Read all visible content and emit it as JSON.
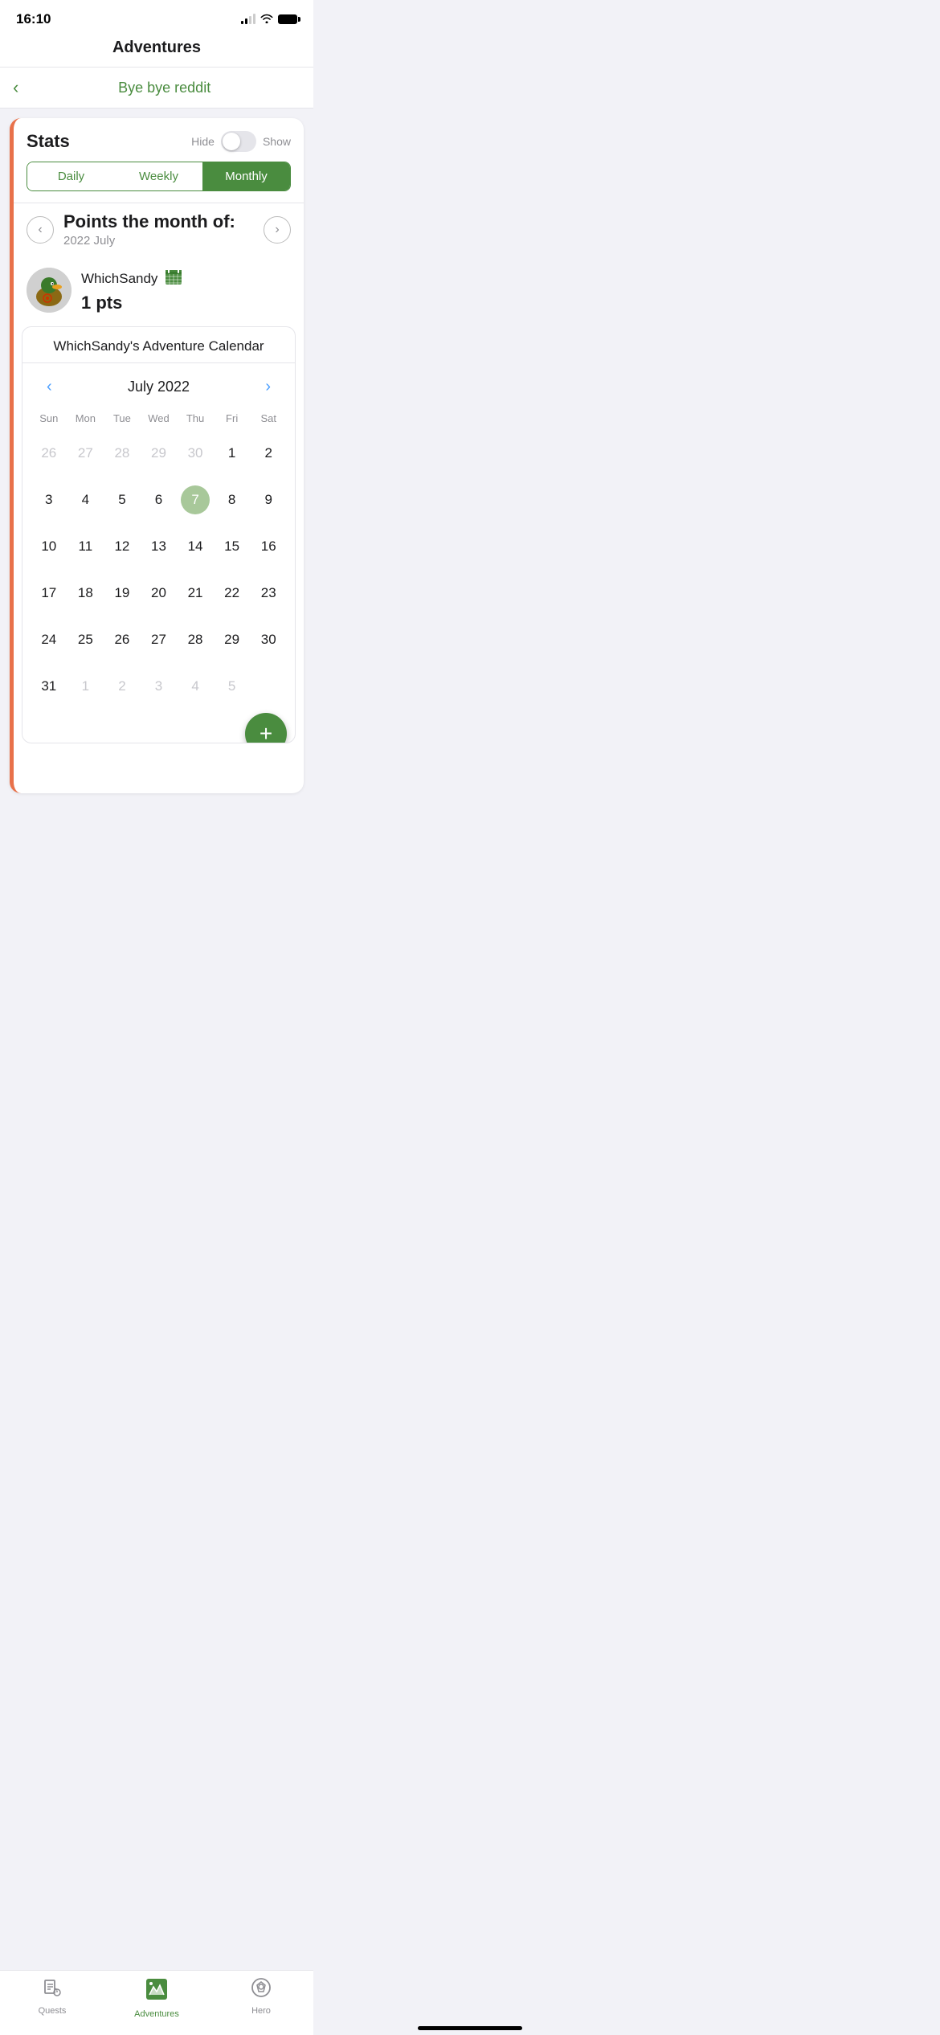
{
  "statusBar": {
    "time": "16:10"
  },
  "header": {
    "title": "Adventures"
  },
  "nav": {
    "backIcon": "‹",
    "adventureName": "Bye bye reddit"
  },
  "stats": {
    "title": "Stats",
    "hideLabel": "Hide",
    "showLabel": "Show",
    "tabs": [
      {
        "id": "daily",
        "label": "Daily",
        "active": false
      },
      {
        "id": "weekly",
        "label": "Weekly",
        "active": false
      },
      {
        "id": "monthly",
        "label": "Monthly",
        "active": true
      }
    ],
    "pointsLabel": "Points the month of:",
    "pointsSubLabel": "2022 July",
    "prevIcon": "‹",
    "nextIcon": "›"
  },
  "user": {
    "name": "WhichSandy",
    "pts": "1 pts",
    "calendarIcon": "📅"
  },
  "calendar": {
    "title": "WhichSandy's Adventure Calendar",
    "monthTitle": "July 2022",
    "prevIcon": "‹",
    "nextIcon": "›",
    "weekdays": [
      "Sun",
      "Mon",
      "Tue",
      "Wed",
      "Thu",
      "Fri",
      "Sat"
    ],
    "weeks": [
      [
        {
          "num": "26",
          "active": false
        },
        {
          "num": "27",
          "active": false
        },
        {
          "num": "28",
          "active": false
        },
        {
          "num": "29",
          "active": false
        },
        {
          "num": "30",
          "active": false
        },
        {
          "num": "1",
          "active": true
        },
        {
          "num": "2",
          "active": true
        }
      ],
      [
        {
          "num": "3",
          "active": true
        },
        {
          "num": "4",
          "active": true
        },
        {
          "num": "5",
          "active": true
        },
        {
          "num": "6",
          "active": true
        },
        {
          "num": "7",
          "active": true,
          "today": true
        },
        {
          "num": "8",
          "active": true
        },
        {
          "num": "9",
          "active": true
        }
      ],
      [
        {
          "num": "10",
          "active": true
        },
        {
          "num": "11",
          "active": true
        },
        {
          "num": "12",
          "active": true
        },
        {
          "num": "13",
          "active": true
        },
        {
          "num": "14",
          "active": true
        },
        {
          "num": "15",
          "active": true
        },
        {
          "num": "16",
          "active": true
        }
      ],
      [
        {
          "num": "17",
          "active": true
        },
        {
          "num": "18",
          "active": true
        },
        {
          "num": "19",
          "active": true
        },
        {
          "num": "20",
          "active": true
        },
        {
          "num": "21",
          "active": true
        },
        {
          "num": "22",
          "active": true
        },
        {
          "num": "23",
          "active": true
        }
      ],
      [
        {
          "num": "24",
          "active": true
        },
        {
          "num": "25",
          "active": true
        },
        {
          "num": "26",
          "active": true
        },
        {
          "num": "27",
          "active": true
        },
        {
          "num": "28",
          "active": true
        },
        {
          "num": "29",
          "active": true
        },
        {
          "num": "30",
          "active": true
        }
      ],
      [
        {
          "num": "31",
          "active": true
        },
        {
          "num": "1",
          "active": false
        },
        {
          "num": "2",
          "active": false
        },
        {
          "num": "3",
          "active": false
        },
        {
          "num": "4",
          "active": false
        },
        {
          "num": "5",
          "active": false
        },
        {
          "num": "",
          "active": false
        }
      ]
    ]
  },
  "fab": {
    "icon": "+"
  },
  "bottomTabs": [
    {
      "id": "quests",
      "label": "Quests",
      "active": false
    },
    {
      "id": "adventures",
      "label": "Adventures",
      "active": true
    },
    {
      "id": "hero",
      "label": "Hero",
      "active": false
    }
  ]
}
